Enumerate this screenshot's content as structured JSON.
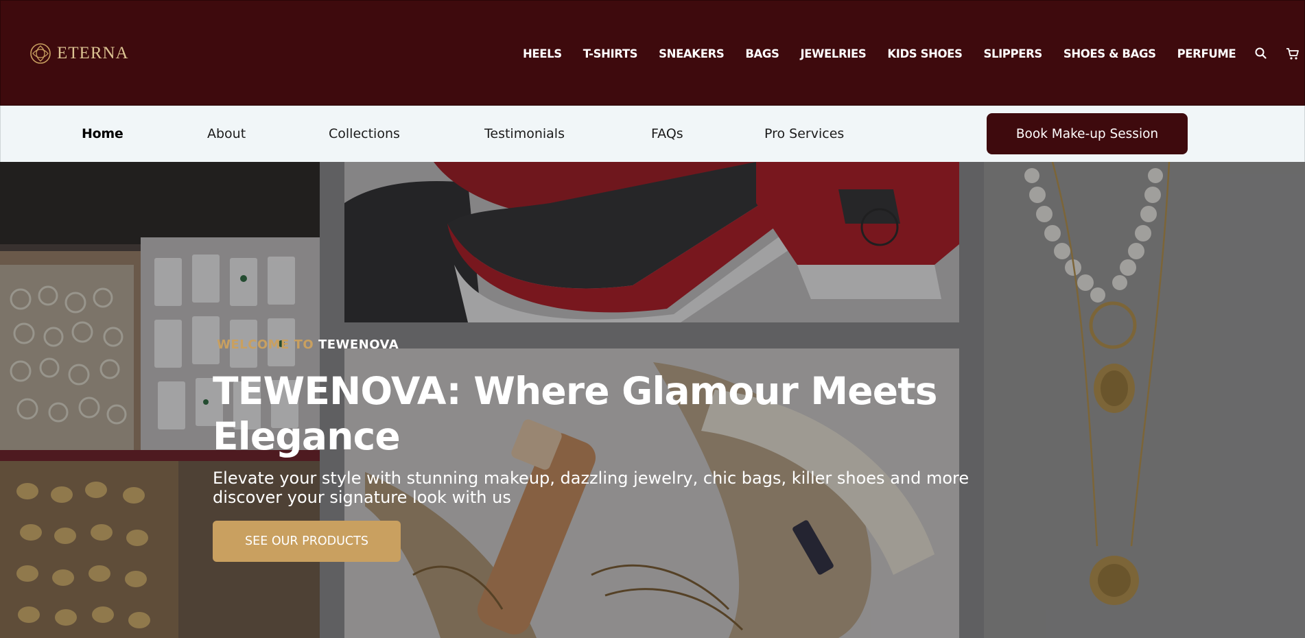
{
  "brand": {
    "logo_text": "ETERNA",
    "icon": "eterna-logo-icon",
    "color": "#dcc392"
  },
  "categories": [
    "HEELS",
    "T-SHIRTS",
    "SNEAKERS",
    "BAGS",
    "JEWELRIES",
    "KIDS SHOES",
    "SLIPPERS",
    "SHOES & BAGS",
    "PERFUME"
  ],
  "header_icons": {
    "search": "search-icon",
    "cart": "cart-icon"
  },
  "nav": {
    "links": [
      "Home",
      "About",
      "Collections",
      "Testimonials",
      "FAQs",
      "Pro Services"
    ],
    "active": "Home",
    "cta_label": "Book Make-up Session"
  },
  "hero": {
    "eyebrow_prefix": "WELCOME TO ",
    "eyebrow_brand": "TEWENOVA",
    "title": "TEWENOVA: Where Glamour Meets Elegance",
    "subtitle": "Elevate your style with stunning makeup, dazzling jewelry, chic bags, killer shoes and more discover your signature look with us",
    "cta_label": "SEE OUR PRODUCTS"
  },
  "colors": {
    "header_bg": "#3e0a0d",
    "subnav_bg": "#f1f6f8",
    "accent_gold": "#c9a060",
    "white": "#ffffff"
  }
}
